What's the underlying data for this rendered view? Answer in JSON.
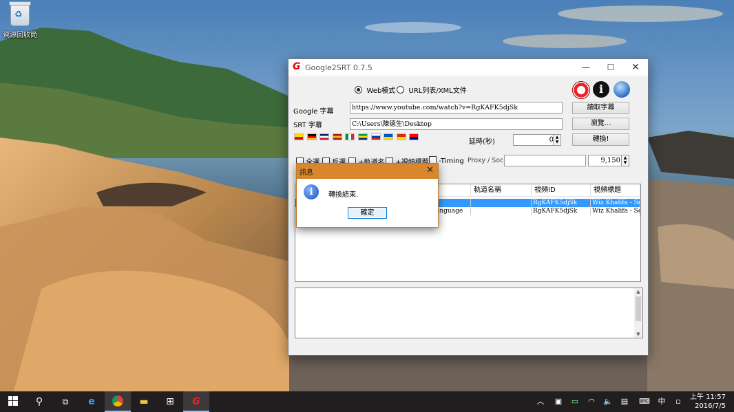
{
  "desktop": {
    "recycle_bin_label": "資源回收筒"
  },
  "window": {
    "title": "Google2SRT 0.7.5",
    "mode_web": "Web模式",
    "mode_url": "URL列表/XML文件",
    "google_label": "Google 字幕",
    "google_value": "https://www.youtube.com/watch?v=RgKAFK5djSk",
    "srt_label": "SRT 字幕",
    "srt_value": "C:\\Users\\陳德生\\Desktop",
    "read_button": "讀取字幕",
    "browse_button": "瀏覽...",
    "convert_button": "轉換!",
    "delay_label": "延時(秒)",
    "delay_value": "0",
    "select_all": "全選",
    "invert": "反選",
    "track_name_opt": "+軌道名",
    "video_title_opt": "+視頻標題",
    "timing_opt": "-Timing",
    "proxy_label": "Proxy / Socks",
    "port_value": "9,150",
    "flags": [
      {
        "name": "catalan",
        "colors": [
          "#fcdd09",
          "#da121a"
        ]
      },
      {
        "name": "german",
        "colors": [
          "#000000",
          "#dd0000",
          "#ffce00"
        ]
      },
      {
        "name": "uk",
        "colors": [
          "#012169",
          "#ffffff",
          "#c8102e"
        ]
      },
      {
        "name": "spanish",
        "colors": [
          "#aa151b",
          "#f1bf00",
          "#aa151b"
        ]
      },
      {
        "name": "italian",
        "colors": [
          "#009246",
          "#ffffff",
          "#ce2b37"
        ]
      },
      {
        "name": "brazil",
        "colors": [
          "#009c3b",
          "#ffdf00",
          "#002776"
        ]
      },
      {
        "name": "russian",
        "colors": [
          "#ffffff",
          "#0039a6",
          "#d52b1e"
        ]
      },
      {
        "name": "ukraine",
        "colors": [
          "#0057b7",
          "#ffd700"
        ]
      },
      {
        "name": "china",
        "colors": [
          "#de2910",
          "#ffde00"
        ]
      },
      {
        "name": "taiwan",
        "colors": [
          "#fe0000",
          "#000095"
        ]
      }
    ],
    "list": {
      "columns": [
        "",
        "軌道名稱",
        "視頻ID",
        "視頻標題"
      ],
      "rows": [
        {
          "lang": "",
          "track": "",
          "id": "RgKAFK5djSk",
          "title": "Wiz Khalifa - Se...",
          "selected": true
        },
        {
          "lang": "anguage",
          "track": "",
          "id": "RgKAFK5djSk",
          "title": "Wiz Khalifa - Se...",
          "selected": false
        }
      ]
    }
  },
  "dialog": {
    "title": "訊息",
    "message": "轉換結束.",
    "ok_button": "確定"
  },
  "taskbar": {
    "time": "上午 11:57",
    "date": "2016/7/5",
    "ime": "中"
  },
  "colors": {
    "accent": "#d9862c",
    "selection": "#3399ff",
    "taskbar": "#1c1612"
  }
}
